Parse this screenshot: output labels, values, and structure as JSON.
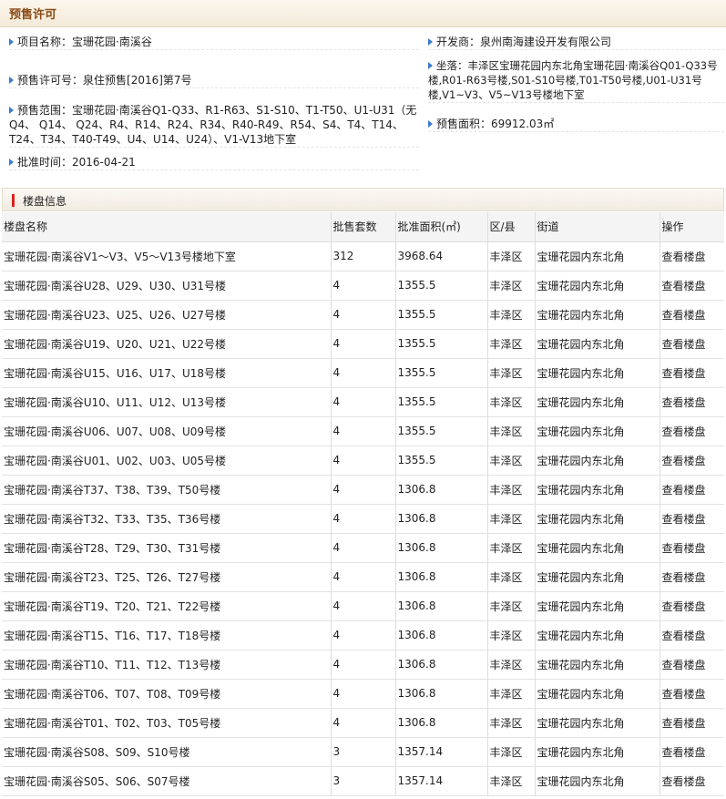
{
  "header": {
    "title": "预售许可"
  },
  "info": {
    "project_label": "项目名称：",
    "project_value": "宝珊花园·南溪谷",
    "developer_label": "开发商：",
    "developer_value": "泉州南海建设开发有限公司",
    "permit_label": "预售许可号：",
    "permit_value": "泉住预售[2016]第7号",
    "location_label": "坐落：",
    "location_value": "丰泽区宝珊花园内东北角宝珊花园·南溪谷Q01-Q33号楼,R01-R63号楼,S01-S10号楼,T01-T50号楼,U01-U31号楼,V1~V3、V5~V13号楼地下室",
    "scope_label": "预售范围：",
    "scope_value": "宝珊花园·南溪谷Q1-Q33、R1-R63、S1-S10、T1-T50、U1-U31（无Q4、 Q14、 Q24、R4、R14、R24、R34、R40-R49、R54、S4、T4、T14、T24、T34、T40-T49、U4、U14、U24）、V1-V13地下室",
    "area_label": "预售面积：",
    "area_value": "69912.03㎡",
    "date_label": "批准时间：",
    "date_value": "2016-04-21"
  },
  "section": {
    "title": "楼盘信息"
  },
  "table": {
    "headers": [
      "楼盘名称",
      "批售套数",
      "批准面积(㎡)",
      "区/县",
      "街道",
      "操作"
    ],
    "rows": [
      [
        "宝珊花园·南溪谷V1～V3、V5～V13号楼地下室",
        "312",
        "3968.64",
        "丰泽区",
        "宝珊花园内东北角",
        "查看楼盘"
      ],
      [
        "宝珊花园·南溪谷U28、U29、U30、U31号楼",
        "4",
        "1355.5",
        "丰泽区",
        "宝珊花园内东北角",
        "查看楼盘"
      ],
      [
        "宝珊花园·南溪谷U23、U25、U26、U27号楼",
        "4",
        "1355.5",
        "丰泽区",
        "宝珊花园内东北角",
        "查看楼盘"
      ],
      [
        "宝珊花园·南溪谷U19、U20、U21、U22号楼",
        "4",
        "1355.5",
        "丰泽区",
        "宝珊花园内东北角",
        "查看楼盘"
      ],
      [
        "宝珊花园·南溪谷U15、U16、U17、U18号楼",
        "4",
        "1355.5",
        "丰泽区",
        "宝珊花园内东北角",
        "查看楼盘"
      ],
      [
        "宝珊花园·南溪谷U10、U11、U12、U13号楼",
        "4",
        "1355.5",
        "丰泽区",
        "宝珊花园内东北角",
        "查看楼盘"
      ],
      [
        "宝珊花园·南溪谷U06、U07、U08、U09号楼",
        "4",
        "1355.5",
        "丰泽区",
        "宝珊花园内东北角",
        "查看楼盘"
      ],
      [
        "宝珊花园·南溪谷U01、U02、U03、U05号楼",
        "4",
        "1355.5",
        "丰泽区",
        "宝珊花园内东北角",
        "查看楼盘"
      ],
      [
        "宝珊花园·南溪谷T37、T38、T39、T50号楼",
        "4",
        "1306.8",
        "丰泽区",
        "宝珊花园内东北角",
        "查看楼盘"
      ],
      [
        "宝珊花园·南溪谷T32、T33、T35、T36号楼",
        "4",
        "1306.8",
        "丰泽区",
        "宝珊花园内东北角",
        "查看楼盘"
      ],
      [
        "宝珊花园·南溪谷T28、T29、T30、T31号楼",
        "4",
        "1306.8",
        "丰泽区",
        "宝珊花园内东北角",
        "查看楼盘"
      ],
      [
        "宝珊花园·南溪谷T23、T25、T26、T27号楼",
        "4",
        "1306.8",
        "丰泽区",
        "宝珊花园内东北角",
        "查看楼盘"
      ],
      [
        "宝珊花园·南溪谷T19、T20、T21、T22号楼",
        "4",
        "1306.8",
        "丰泽区",
        "宝珊花园内东北角",
        "查看楼盘"
      ],
      [
        "宝珊花园·南溪谷T15、T16、T17、T18号楼",
        "4",
        "1306.8",
        "丰泽区",
        "宝珊花园内东北角",
        "查看楼盘"
      ],
      [
        "宝珊花园·南溪谷T10、T11、T12、T13号楼",
        "4",
        "1306.8",
        "丰泽区",
        "宝珊花园内东北角",
        "查看楼盘"
      ],
      [
        "宝珊花园·南溪谷T06、T07、T08、T09号楼",
        "4",
        "1306.8",
        "丰泽区",
        "宝珊花园内东北角",
        "查看楼盘"
      ],
      [
        "宝珊花园·南溪谷T01、T02、T03、T05号楼",
        "4",
        "1306.8",
        "丰泽区",
        "宝珊花园内东北角",
        "查看楼盘"
      ],
      [
        "宝珊花园·南溪谷S08、S09、S10号楼",
        "3",
        "1357.14",
        "丰泽区",
        "宝珊花园内东北角",
        "查看楼盘"
      ],
      [
        "宝珊花园·南溪谷S05、S06、S07号楼",
        "3",
        "1357.14",
        "丰泽区",
        "宝珊花园内东北角",
        "查看楼盘"
      ]
    ]
  }
}
